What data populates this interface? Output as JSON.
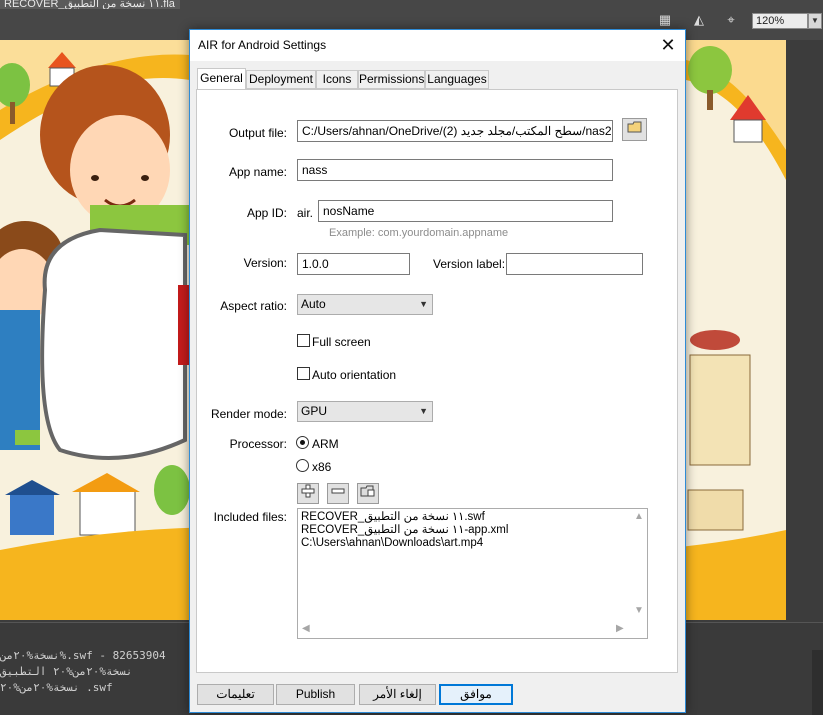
{
  "app": {
    "doc_tab": "RECOVER_١١ نسخة من التطبيق.fla",
    "zoom": "120%",
    "output_lines": [
      "نسخة%٢٠من%.swf - 82653904",
      "نسخة%٢٠من%٢٠ التطبيق",
      "نسخة%٢٠من%٢٠ .swf"
    ]
  },
  "dialog": {
    "title": "AIR for Android Settings",
    "close_glyph": "✕",
    "tabs": [
      {
        "label": "General",
        "active": true
      },
      {
        "label": "Deployment"
      },
      {
        "label": "Icons"
      },
      {
        "label": "Permissions"
      },
      {
        "label": "Languages"
      }
    ],
    "output_file": {
      "label": "Output file:",
      "value": "C:/Users/ahnan/OneDrive/سطح المكتب/مجلد جديد (2)/nas2.apk"
    },
    "app_name": {
      "label": "App name:",
      "value": "nass"
    },
    "app_id": {
      "label": "App ID:",
      "prefix": "air.",
      "value": "nosName",
      "hint": "Example: com.yourdomain.appname"
    },
    "version": {
      "label": "Version:",
      "value": "1.0.0",
      "version_label": "Version label:",
      "version_label_value": ""
    },
    "aspect_ratio": {
      "label": "Aspect ratio:",
      "selected": "Auto"
    },
    "full_screen": {
      "label": "Full screen",
      "checked": false
    },
    "auto_orientation": {
      "label": "Auto orientation",
      "checked": false
    },
    "render_mode": {
      "label": "Render mode:",
      "selected": "GPU"
    },
    "processor": {
      "label": "Processor:",
      "options": [
        "ARM",
        "x86"
      ],
      "selected": "ARM"
    },
    "included_files": {
      "label": "Included files:",
      "files": [
        "RECOVER_١١ نسخة من التطبيق.swf",
        "RECOVER_١١ نسخة من التطبيق-app.xml",
        "C:\\Users\\ahnan\\Downloads\\art.mp4"
      ]
    },
    "buttons": {
      "help": "تعليمات",
      "publish": "Publish",
      "cancel": "إلغاء الأمر",
      "ok": "موافق"
    }
  }
}
